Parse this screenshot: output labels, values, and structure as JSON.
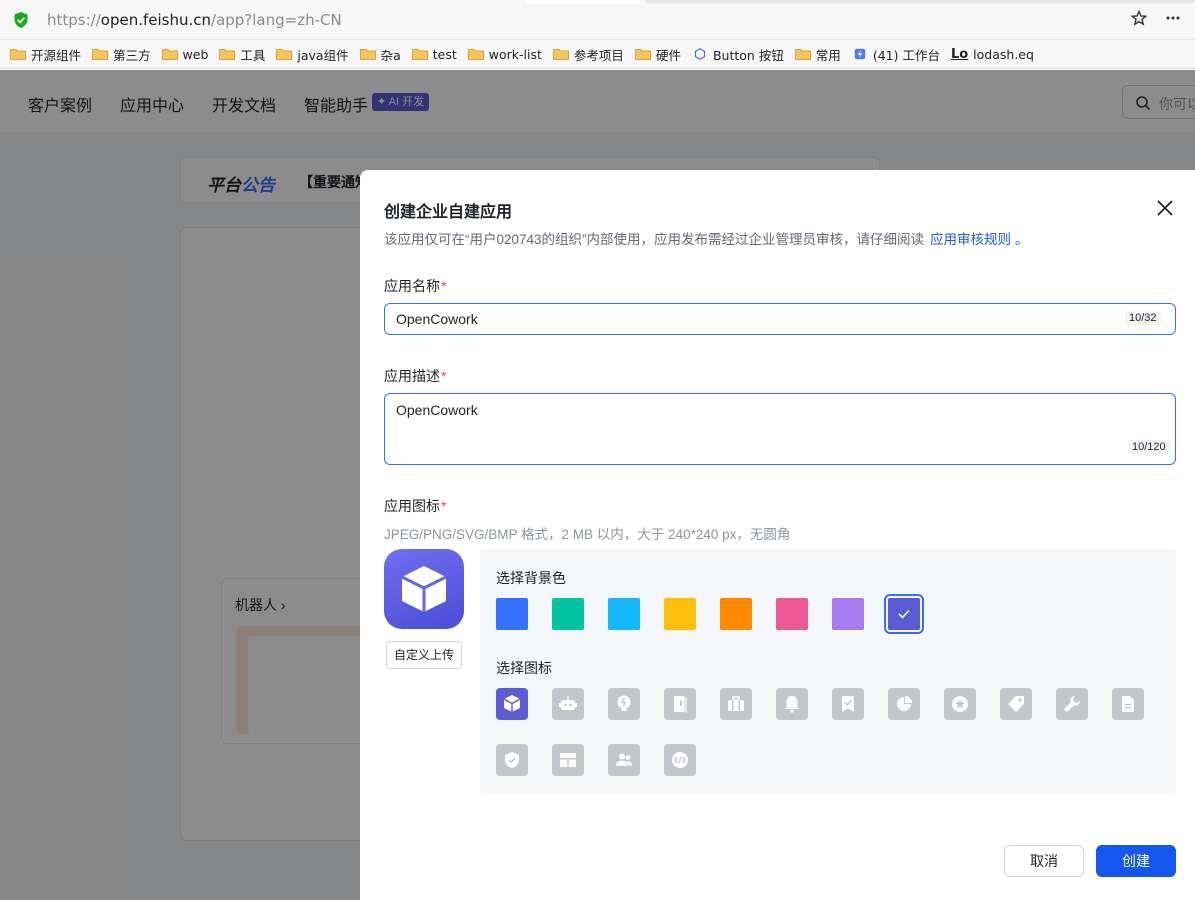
{
  "browser": {
    "url_prefix": "https://",
    "url_host": "open.feishu.cn",
    "url_path": "/app?lang=zh-CN",
    "bookmarks": [
      "开源组件",
      "第三方",
      "web",
      "工具",
      "java组件",
      "杂a",
      "test",
      "work-list",
      "参考项目",
      "硬件",
      "Button 按钮",
      "常用",
      "(41) 工作台",
      "lodash.eq"
    ]
  },
  "page": {
    "nav": [
      "客户案例",
      "应用中心",
      "开发文档",
      "智能助手"
    ],
    "ai_badge": "✦ AI 开发",
    "search_placeholder": "你可以",
    "notice_title_a": "平台",
    "notice_title_b": "公告",
    "notice_text": "【重要通知",
    "robot_label": "机器人 ›"
  },
  "modal": {
    "title": "创建企业自建应用",
    "subtitle": "该应用仅可在“用户020743的组织”内部使用，应用发布需经过企业管理员审核，请仔细阅读",
    "rule_link": "应用审核规则",
    "rule_suffix": "。",
    "name_label": "应用名称",
    "name_value": "OpenCowork",
    "name_counter": "10/32",
    "desc_label": "应用描述",
    "desc_value": "OpenCowork",
    "desc_counter": "10/120",
    "icon_label": "应用图标",
    "icon_hint": "JPEG/PNG/SVG/BMP 格式，2 MB 以内，大于 240*240 px，无圆角",
    "upload_label": "自定义上传",
    "bg_label": "选择背景色",
    "icon_pick_label": "选择图标",
    "bg_colors": [
      "#3370ff",
      "#00c4a0",
      "#14b8ff",
      "#ffbe0a",
      "#ff8800",
      "#ee5893",
      "#a97bf2",
      "#5b5bd6"
    ],
    "icons": [
      "cube-icon",
      "robot-icon",
      "bulb-icon",
      "book-icon",
      "briefcase-icon",
      "bell-icon",
      "bookmark-check-icon",
      "pie-icon",
      "star-badge-icon",
      "tag-icon",
      "wrench-icon",
      "document-icon",
      "shield-check-icon",
      "layout-icon",
      "people-icon",
      "code-icon"
    ],
    "cancel": "取消",
    "create": "创建"
  }
}
